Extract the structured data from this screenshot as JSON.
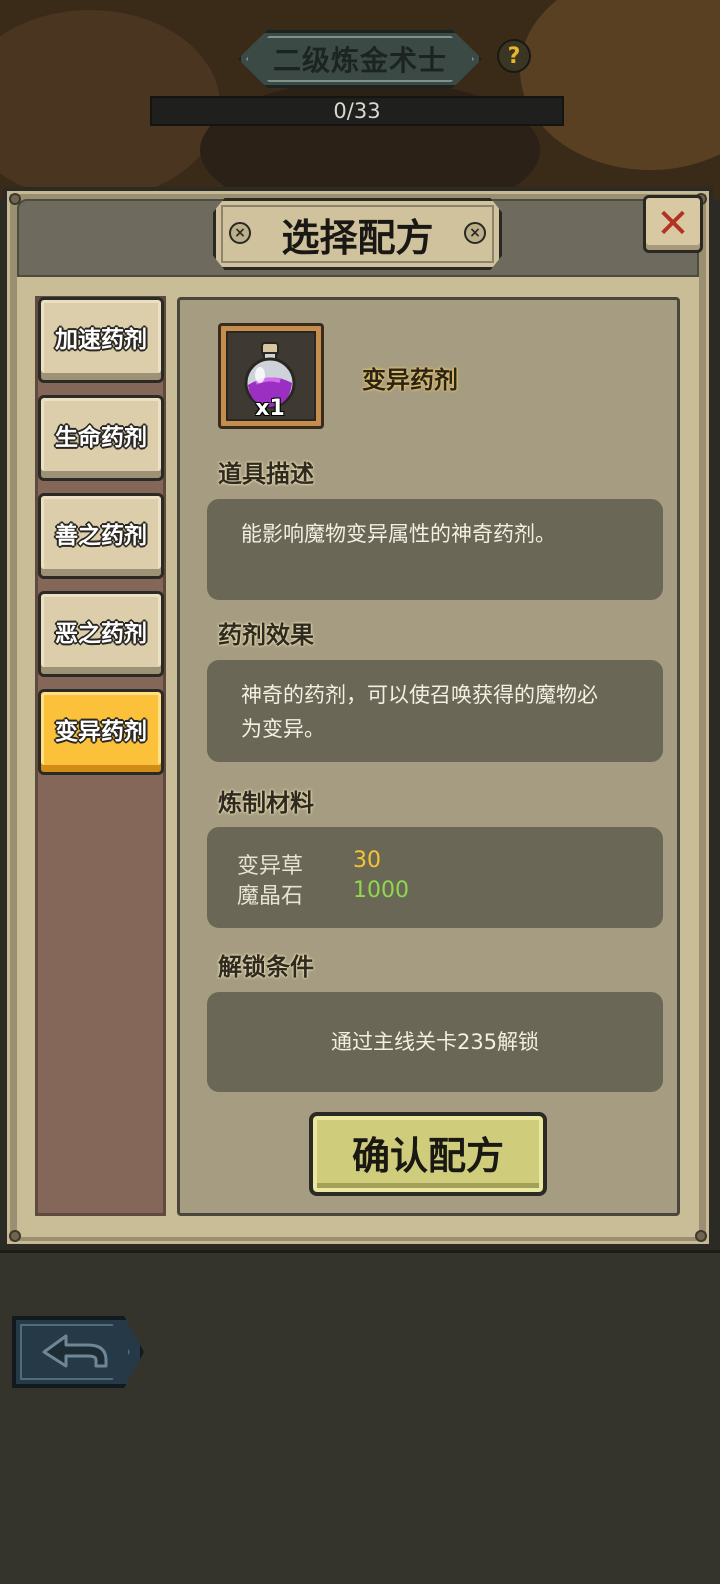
{
  "header": {
    "title": "二级炼金术士",
    "help_icon": "?",
    "progress_text": "0/33",
    "progress_value": 0
  },
  "panel": {
    "title": "选择配方",
    "close_icon": "✕"
  },
  "recipes": [
    {
      "label": "加速药剂",
      "active": false
    },
    {
      "label": "生命药剂",
      "active": false
    },
    {
      "label": "善之药剂",
      "active": false
    },
    {
      "label": "恶之药剂",
      "active": false
    },
    {
      "label": "变异药剂",
      "active": true
    }
  ],
  "detail": {
    "item_icon": "purple-potion-icon",
    "item_count": "x1",
    "item_name": "变异药剂",
    "description_title": "道具描述",
    "description": "能影响魔物变异属性的神奇药剂。",
    "effect_title": "药剂效果",
    "effect_line1": "神奇的药剂，可以使召唤获得的魔物必",
    "effect_line2": "为变异。",
    "materials_title": "炼制材料",
    "materials": [
      {
        "name": "变异草",
        "qty": "30",
        "color": "#f5c531"
      },
      {
        "name": "魔晶石",
        "qty": "1000",
        "color": "#8fd84e"
      }
    ],
    "unlock_title": "解锁条件",
    "unlock_text": "通过主线关卡235解锁",
    "confirm_label": "确认配方"
  },
  "nav": {
    "back_icon": "back-arrow-icon"
  },
  "colors": {
    "accent_gold": "#fbc13b",
    "panel_tan": "#c9bd97",
    "close_red": "#b23326",
    "confirm_green": "#cfcd7c"
  }
}
